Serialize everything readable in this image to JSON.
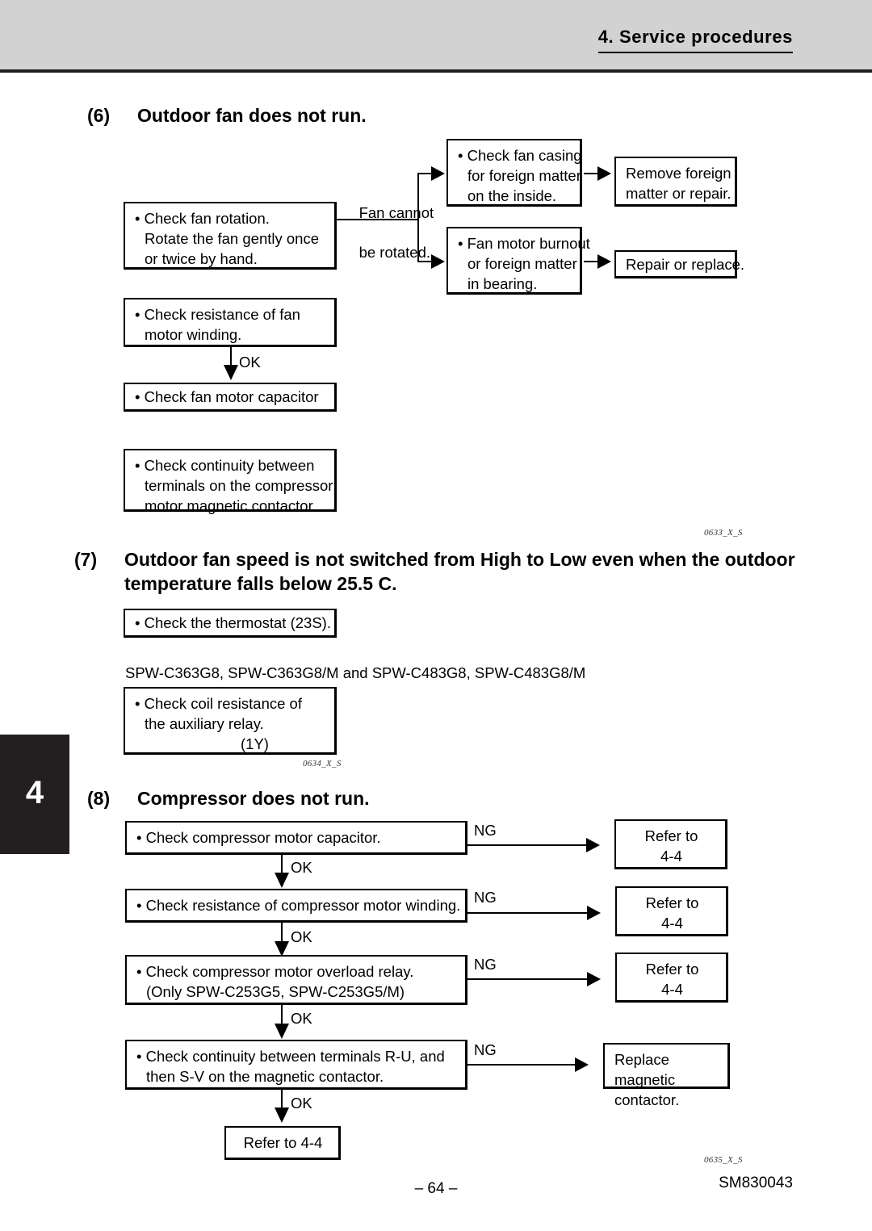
{
  "header": {
    "title": "4.  Service procedures"
  },
  "chapter_tab": {
    "number": "4"
  },
  "sections": {
    "six": {
      "number": "(6)",
      "title": "Outdoor fan does not run.",
      "figure_id": "0633_X_S",
      "boxes": {
        "check_fan_rotation": {
          "line1": "• Check fan rotation.",
          "line2": "Rotate the fan gently once",
          "line3": "or twice by hand."
        },
        "check_fan_casing": {
          "line1": "• Check fan casing",
          "line2": "for foreign matter",
          "line3": "on the inside."
        },
        "remove_foreign_matter": {
          "line1": "Remove foreign",
          "line2": "matter or repair."
        },
        "fan_motor_burnout": {
          "line1": "• Fan motor burnout",
          "line2": "or foreign matter",
          "line3": "in bearing."
        },
        "repair_or_replace": {
          "line1": "Repair or replace."
        },
        "check_resistance": {
          "line1": "• Check resistance of fan",
          "line2": "motor winding."
        },
        "check_capacitor": {
          "line1": "• Check fan motor capacitor"
        },
        "check_continuity": {
          "line1": "• Check continuity between",
          "line2": "terminals on the compressor",
          "line3": "motor magnetic contactor."
        }
      },
      "labels": {
        "fan_cannot_line1": "Fan cannot",
        "fan_cannot_line2": "be rotated.",
        "ok": "OK"
      }
    },
    "seven": {
      "number": "(7)",
      "title_line1": "Outdoor fan speed is not switched from High to Low even when the outdoor",
      "title_line2": "temperature falls below 25.5 C.",
      "figure_id": "0634_X_S",
      "models_note": "SPW-C363G8, SPW-C363G8/M and SPW-C483G8, SPW-C483G8/M",
      "boxes": {
        "check_thermostat": {
          "line1": "• Check the thermostat (23S)."
        },
        "check_coil_resistance": {
          "line1": "• Check coil resistance of",
          "line2": "the auxiliary relay.",
          "line3": "(1Y)"
        }
      }
    },
    "eight": {
      "number": "(8)",
      "title": "Compressor does not run.",
      "figure_id": "0635_X_S",
      "boxes": {
        "check_compressor_capacitor": {
          "line1": "• Check compressor motor capacitor."
        },
        "check_compressor_winding": {
          "line1": "• Check resistance of compressor motor winding."
        },
        "check_overload_relay": {
          "line1": "• Check compressor motor overload relay.",
          "line2": "(Only SPW-C253G5, SPW-C253G5/M)"
        },
        "check_terminals": {
          "line1": "• Check continuity between terminals R-U, and",
          "line2": "then S-V on the magnetic contactor."
        },
        "refer_1": {
          "line1": "Refer to",
          "line2": "4-4"
        },
        "refer_2": {
          "line1": "Refer to",
          "line2": "4-4"
        },
        "refer_3": {
          "line1": "Refer to",
          "line2": "4-4"
        },
        "replace_contactor": {
          "line1": "Replace magnetic",
          "line2": "contactor."
        },
        "refer_final": {
          "line1": "Refer to 4-4"
        }
      },
      "labels": {
        "ng1": "NG",
        "ng2": "NG",
        "ng3": "NG",
        "ng4": "NG",
        "ok1": "OK",
        "ok2": "OK",
        "ok3": "OK",
        "ok4": "OK"
      }
    }
  },
  "footer": {
    "page_number": "– 64 –",
    "document_code": "SM830043"
  }
}
